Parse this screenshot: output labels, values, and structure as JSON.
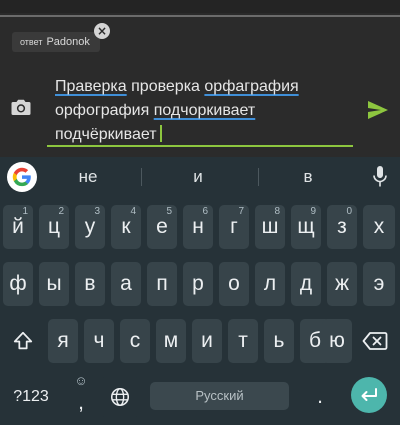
{
  "compose": {
    "reply_prefix": "ответ",
    "reply_name": "Padonok",
    "reply_close_glyph": "×",
    "message_words": [
      [
        "Праверка",
        "проверка",
        "орфаграфия"
      ],
      [
        "орфография",
        "подчоркивает"
      ],
      [
        "подчёркивает"
      ]
    ],
    "spell_flagged": [
      "Праверка",
      "орфаграфия",
      "подчоркивает"
    ]
  },
  "suggestions": {
    "items": [
      "не",
      "и",
      "в"
    ]
  },
  "keyboard": {
    "row1": [
      {
        "label": "й",
        "hint": "1"
      },
      {
        "label": "ц",
        "hint": "2"
      },
      {
        "label": "у",
        "hint": "3"
      },
      {
        "label": "к",
        "hint": "4"
      },
      {
        "label": "е",
        "hint": "5"
      },
      {
        "label": "н",
        "hint": "6"
      },
      {
        "label": "г",
        "hint": "7"
      },
      {
        "label": "ш",
        "hint": "8"
      },
      {
        "label": "щ",
        "hint": "9"
      },
      {
        "label": "з",
        "hint": "0"
      },
      {
        "label": "х",
        "hint": ""
      }
    ],
    "row2": [
      "ф",
      "ы",
      "в",
      "а",
      "п",
      "р",
      "о",
      "л",
      "д",
      "ж",
      "э"
    ],
    "row3": [
      "я",
      "ч",
      "с",
      "м",
      "и",
      "т",
      "ь",
      "б",
      "ю"
    ],
    "symbols_label": "?123",
    "emoji_glyph": "☺",
    "comma_glyph": ",",
    "space_label": "Русский",
    "period_glyph": "."
  },
  "colors": {
    "accent_green": "#8dc63f",
    "spellcheck_blue": "#3f8fd8",
    "enter_teal": "#4db6ac",
    "keyboard_bg": "#263238",
    "key_bg": "#37444a"
  },
  "icons": {
    "reply_close": "close-icon",
    "camera": "camera-icon",
    "send": "send-icon",
    "google": "google-icon",
    "mic": "mic-icon",
    "shift": "shift-icon",
    "backspace": "backspace-icon",
    "emoji": "emoji-icon",
    "globe": "globe-icon",
    "enter": "enter-icon"
  }
}
